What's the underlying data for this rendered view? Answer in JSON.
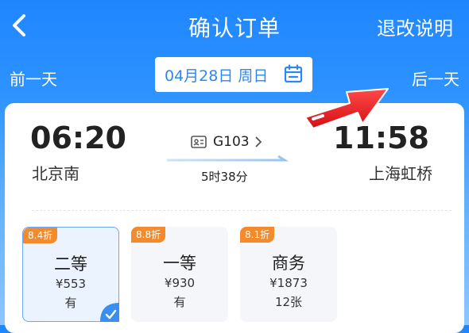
{
  "header": {
    "title": "确认订单",
    "policy_link": "退改说明",
    "back_icon": "chevron-left-icon"
  },
  "date_bar": {
    "prev_label": "前一天",
    "next_label": "后一天",
    "date": "04月28日 周日",
    "calendar_icon": "calendar-icon"
  },
  "trip": {
    "departure_time": "06:20",
    "departure_station": "北京南",
    "arrival_time": "11:58",
    "arrival_station": "上海虹桥",
    "train_number": "G103",
    "duration": "5时38分"
  },
  "seats": [
    {
      "discount": "8.4折",
      "name": "二等",
      "price": "¥553",
      "availability": "有",
      "selected": true
    },
    {
      "discount": "8.8折",
      "name": "一等",
      "price": "¥930",
      "availability": "有",
      "selected": false
    },
    {
      "discount": "8.1折",
      "name": "商务",
      "price": "¥1873",
      "availability": "12张",
      "selected": false
    }
  ],
  "colors": {
    "header_blue": "#1f86ff",
    "accent_blue": "#2f86f1",
    "discount_orange": "#f38a2b",
    "annotation_red": "#e8161b"
  }
}
